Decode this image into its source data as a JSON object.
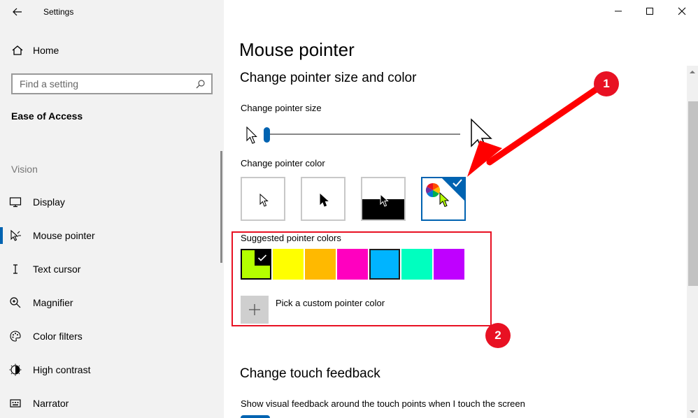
{
  "app": {
    "title": "Settings"
  },
  "sidebar": {
    "home_label": "Home",
    "search_placeholder": "Find a setting",
    "section_title": "Ease of Access",
    "group_label": "Vision",
    "items": [
      {
        "label": "Display",
        "icon": "display-icon"
      },
      {
        "label": "Mouse pointer",
        "icon": "mouse-pointer-icon",
        "active": true
      },
      {
        "label": "Text cursor",
        "icon": "text-cursor-icon"
      },
      {
        "label": "Magnifier",
        "icon": "magnifier-icon"
      },
      {
        "label": "Color filters",
        "icon": "color-filters-icon"
      },
      {
        "label": "High contrast",
        "icon": "high-contrast-icon"
      },
      {
        "label": "Narrator",
        "icon": "narrator-icon"
      }
    ]
  },
  "main": {
    "page_title": "Mouse pointer",
    "size_color_heading": "Change pointer size and color",
    "pointer_size_label": "Change pointer size",
    "pointer_size_value": 1,
    "pointer_color_label": "Change pointer color",
    "pointer_color_options": [
      "white",
      "black",
      "inverted",
      "custom"
    ],
    "pointer_color_selected": "custom",
    "suggested_label": "Suggested pointer colors",
    "suggested_colors": [
      "#b4ff00",
      "#ffff00",
      "#ffb900",
      "#ff00bf",
      "#00b4ff",
      "#00ffbf",
      "#bf00ff"
    ],
    "suggested_selected_index": 0,
    "custom_color_label": "Pick a custom pointer color",
    "touch_heading": "Change touch feedback",
    "touch_label": "Show visual feedback around the touch points when I touch the screen"
  },
  "annotations": {
    "badge1": "1",
    "badge2": "2",
    "accent": "#e81123"
  },
  "theme": {
    "accent": "#0063b1"
  }
}
